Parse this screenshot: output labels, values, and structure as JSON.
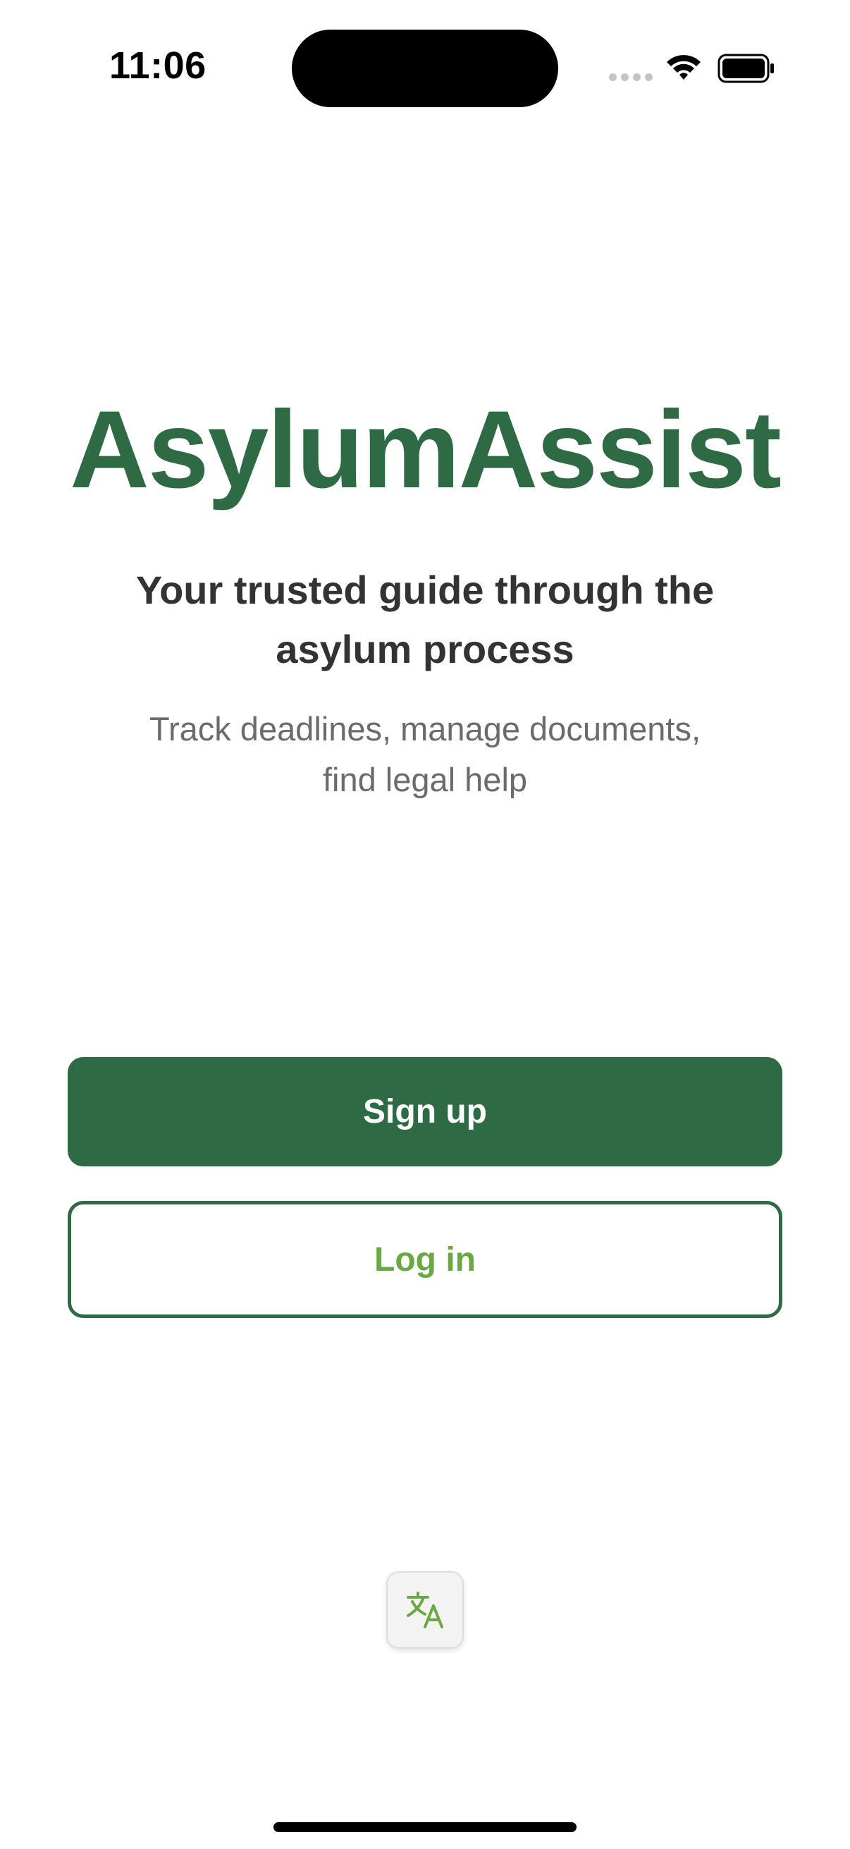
{
  "status_bar": {
    "time": "11:06"
  },
  "app": {
    "title": "AsylumAssist",
    "tagline": "Your trusted guide through the asylum process",
    "subtitle": "Track deadlines, manage documents, find legal help"
  },
  "actions": {
    "signup_label": "Sign up",
    "login_label": "Log in"
  },
  "icons": {
    "language": "translate-icon",
    "wifi": "wifi-icon",
    "battery": "battery-icon",
    "signal": "signal-icon"
  },
  "colors": {
    "brand_green": "#2e6b45",
    "login_text_green": "#6aa844",
    "tagline_text": "#333333",
    "subtitle_text": "#6b6b6b"
  }
}
